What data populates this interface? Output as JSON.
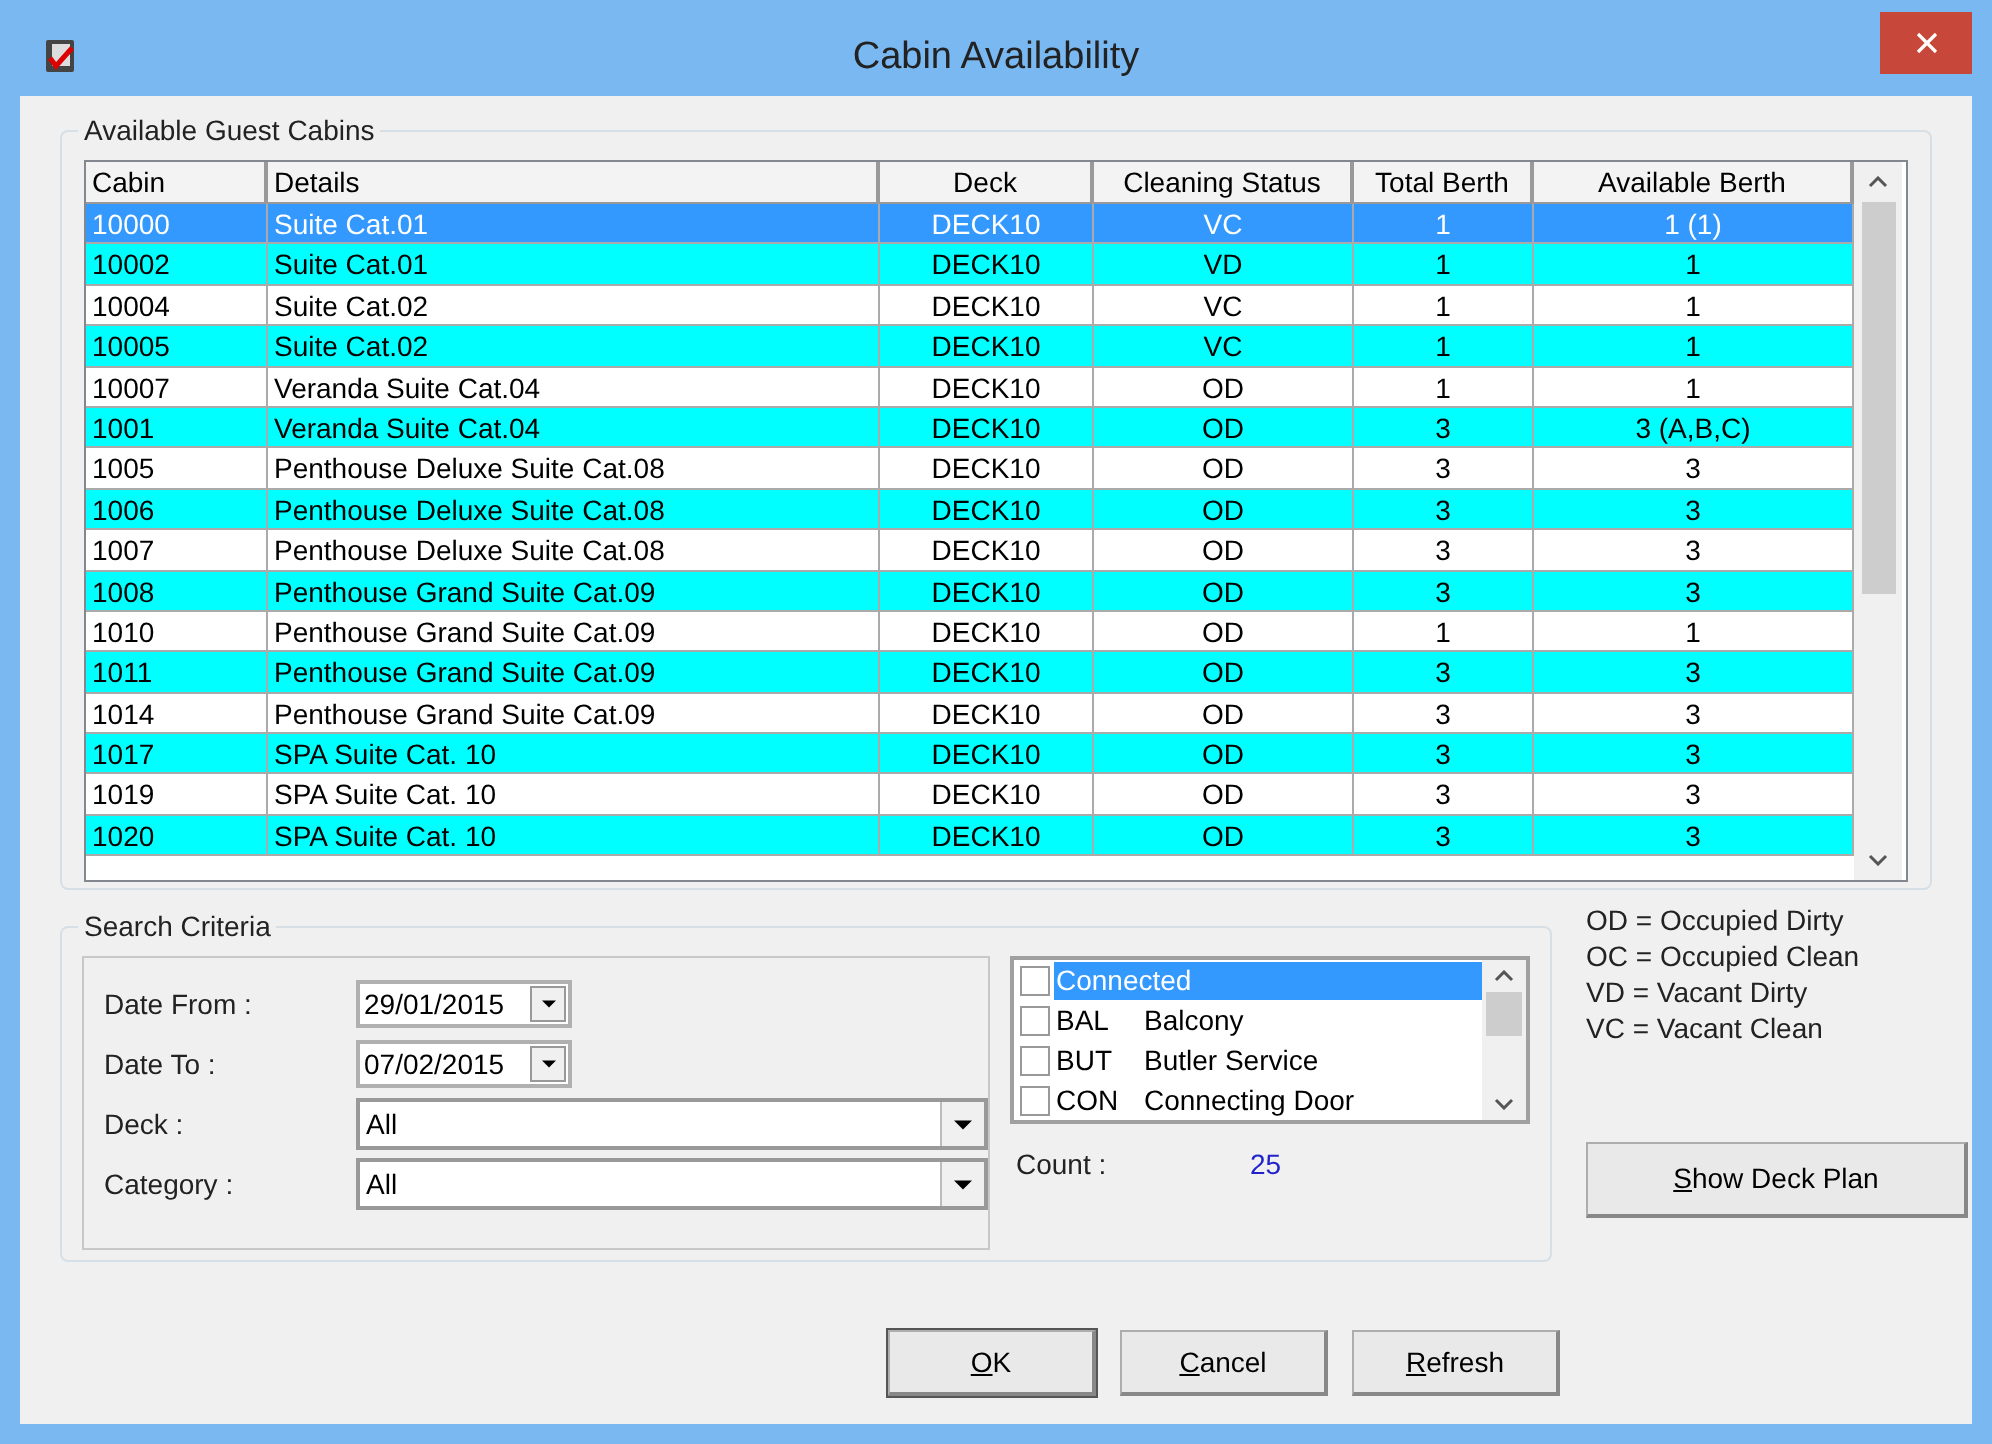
{
  "window": {
    "title": "Cabin Availability"
  },
  "cabins_group": {
    "title": "Available Guest Cabins",
    "columns": [
      "Cabin",
      "Details",
      "Deck",
      "Cleaning Status",
      "Total Berth",
      "Available Berth"
    ],
    "rows": [
      {
        "cells": [
          "10000",
          "Suite Cat.01",
          "DECK10",
          "VC",
          "1",
          "1 (1)"
        ],
        "selected": true
      },
      {
        "cells": [
          "10002",
          "Suite Cat.01",
          "DECK10",
          "VD",
          "1",
          "1"
        ],
        "selected": false
      },
      {
        "cells": [
          "10004",
          "Suite Cat.02",
          "DECK10",
          "VC",
          "1",
          "1"
        ],
        "selected": false
      },
      {
        "cells": [
          "10005",
          "Suite Cat.02",
          "DECK10",
          "VC",
          "1",
          "1"
        ],
        "selected": false
      },
      {
        "cells": [
          "10007",
          "Veranda Suite Cat.04",
          "DECK10",
          "OD",
          "1",
          "1"
        ],
        "selected": false
      },
      {
        "cells": [
          "1001",
          "Veranda Suite Cat.04",
          "DECK10",
          "OD",
          "3",
          "3 (A,B,C)"
        ],
        "selected": false
      },
      {
        "cells": [
          "1005",
          "Penthouse Deluxe Suite Cat.08",
          "DECK10",
          "OD",
          "3",
          "3"
        ],
        "selected": false
      },
      {
        "cells": [
          "1006",
          "Penthouse Deluxe Suite Cat.08",
          "DECK10",
          "OD",
          "3",
          "3"
        ],
        "selected": false
      },
      {
        "cells": [
          "1007",
          "Penthouse Deluxe Suite Cat.08",
          "DECK10",
          "OD",
          "3",
          "3"
        ],
        "selected": false
      },
      {
        "cells": [
          "1008",
          "Penthouse Grand Suite Cat.09",
          "DECK10",
          "OD",
          "3",
          "3"
        ],
        "selected": false
      },
      {
        "cells": [
          "1010",
          "Penthouse Grand Suite Cat.09",
          "DECK10",
          "OD",
          "1",
          "1"
        ],
        "selected": false
      },
      {
        "cells": [
          "1011",
          "Penthouse Grand Suite Cat.09",
          "DECK10",
          "OD",
          "3",
          "3"
        ],
        "selected": false
      },
      {
        "cells": [
          "1014",
          "Penthouse Grand Suite Cat.09",
          "DECK10",
          "OD",
          "3",
          "3"
        ],
        "selected": false
      },
      {
        "cells": [
          "1017",
          "SPA Suite Cat. 10",
          "DECK10",
          "OD",
          "3",
          "3"
        ],
        "selected": false
      },
      {
        "cells": [
          "1019",
          "SPA Suite Cat. 10",
          "DECK10",
          "OD",
          "3",
          "3"
        ],
        "selected": false
      },
      {
        "cells": [
          "1020",
          "SPA Suite Cat. 10",
          "DECK10",
          "OD",
          "3",
          "3"
        ],
        "selected": false
      }
    ]
  },
  "search_group": {
    "title": "Search Criteria",
    "fields": [
      {
        "kind": "date",
        "label": "Date From :",
        "value": "29/01/2015"
      },
      {
        "kind": "date",
        "label": "Date To :",
        "value": "07/02/2015"
      },
      {
        "kind": "combo",
        "label": "Deck :",
        "value": "All"
      },
      {
        "kind": "combo",
        "label": "Category :",
        "value": "All"
      }
    ],
    "features": [
      {
        "name": "Connected",
        "checked": false,
        "selected": true
      },
      {
        "code": "BAL",
        "name": "Balcony",
        "checked": false,
        "selected": false
      },
      {
        "code": "BUT",
        "name": "Butler Service",
        "checked": false,
        "selected": false
      },
      {
        "code": "CON",
        "name": "Connecting Door",
        "checked": false,
        "selected": false
      }
    ],
    "count_label": "Count :",
    "count": "25"
  },
  "legend": [
    "OD = Occupied Dirty",
    "OC = Occupied Clean",
    "VD = Vacant Dirty",
    "VC = Vacant Clean"
  ],
  "side_button": "Show Deck Plan",
  "buttons": [
    "OK",
    "Cancel",
    "Refresh"
  ]
}
